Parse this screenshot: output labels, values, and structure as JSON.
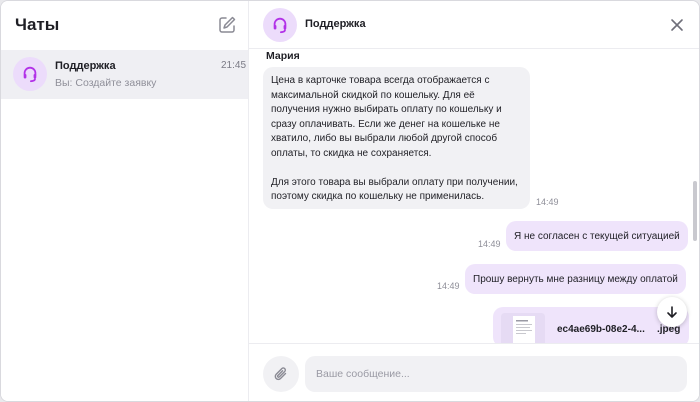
{
  "sidebar": {
    "title": "Чаты",
    "compose_icon": "edit-icon",
    "chats": [
      {
        "name": "Поддержка",
        "time": "21:45",
        "preview": "Вы: Создайте заявку",
        "icon": "headset-icon"
      }
    ]
  },
  "header": {
    "title": "Поддержка",
    "avatar_icon": "headset-icon",
    "close_icon": "close-icon"
  },
  "messages": {
    "incoming": {
      "sender": "Мария",
      "paragraph1": [
        "Цена в карточке товара всегда отображается с",
        "максимальной скидкой по кошельку. Для её",
        "получения нужно выбирать оплату по кошельку и",
        "сразу оплачивать. Если же денег на кошельке не",
        "хватило, либо вы выбрали любой другой способ",
        "оплаты, то скидка не сохраняется."
      ],
      "paragraph2": [
        "Для этого товара вы выбрали оплату при получении,",
        "поэтому скидка по кошельку не применилась."
      ],
      "time": "14:49"
    },
    "outgoing": [
      {
        "text": "Я не согласен с текущей ситуацией",
        "time": "14:49"
      },
      {
        "text": "Прошу вернуть мне разницу между оплатой",
        "time": "14:49"
      }
    ],
    "file": {
      "name": "ec4ae69b-08e2-4...",
      "ext": ".jpeg"
    },
    "scroll_down_icon": "arrow-down-icon"
  },
  "composer": {
    "placeholder": "Ваше сообщение...",
    "value": "",
    "attach_icon": "paperclip-icon"
  },
  "colors": {
    "accent": "#b232e8",
    "outgoing_bubble": "#efe4fb",
    "incoming_bubble": "#f1f1f4",
    "avatar_bg": "#ecdcfb"
  }
}
